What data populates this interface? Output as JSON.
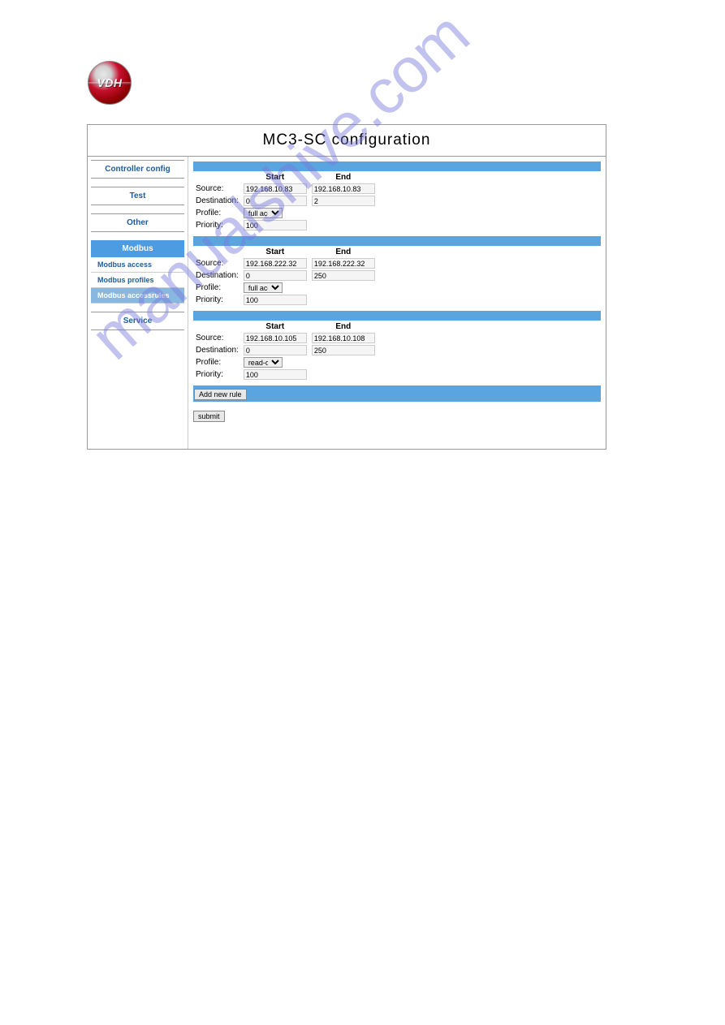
{
  "logo": {
    "text": "VDH"
  },
  "title": "MC3-SC configuration",
  "watermark": "manualshive.com",
  "sidebar": {
    "items": [
      {
        "label": "Controller config"
      },
      {
        "label": "Test"
      },
      {
        "label": "Other"
      },
      {
        "label": "Modbus"
      },
      {
        "label": "Service"
      }
    ],
    "modbus_sub": [
      {
        "label": "Modbus access"
      },
      {
        "label": "Modbus profiles"
      },
      {
        "label": "Modbus accessrules"
      }
    ]
  },
  "table": {
    "headers": {
      "start": "Start",
      "end": "End"
    },
    "labels": {
      "source": "Source:",
      "destination": "Destination:",
      "profile": "Profile:",
      "priority": "Priority:"
    }
  },
  "rules": [
    {
      "source_start": "192.168.10.83",
      "source_end": "192.168.10.83",
      "dest_start": "0",
      "dest_end": "2",
      "profile": "full access",
      "priority": "100"
    },
    {
      "source_start": "192.168.222.32",
      "source_end": "192.168.222.32",
      "dest_start": "0",
      "dest_end": "250",
      "profile": "full access",
      "priority": "100"
    },
    {
      "source_start": "192.168.10.105",
      "source_end": "192.168.10.108",
      "dest_start": "0",
      "dest_end": "250",
      "profile": "read-only",
      "priority": "100"
    }
  ],
  "buttons": {
    "add_rule": "Add new rule",
    "submit": "submit"
  }
}
